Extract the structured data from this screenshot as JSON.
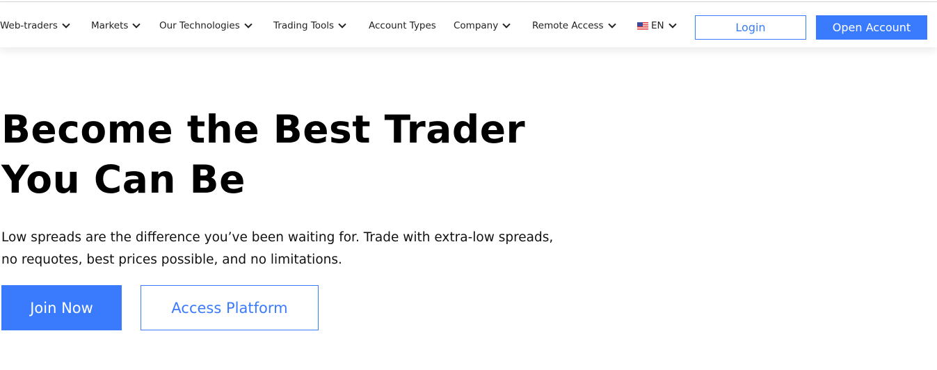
{
  "colors": {
    "accent": "#3a7bfd",
    "text": "#111111",
    "background": "#ffffff"
  },
  "nav": {
    "items": [
      {
        "label": "Web-traders",
        "dropdown": true
      },
      {
        "label": "Markets",
        "dropdown": true
      },
      {
        "label": "Our Technologies",
        "dropdown": true
      },
      {
        "label": "Trading Tools",
        "dropdown": true
      },
      {
        "label": "Account Types",
        "dropdown": false
      },
      {
        "label": "Company",
        "dropdown": true
      },
      {
        "label": "Remote Access",
        "dropdown": true
      }
    ],
    "language": {
      "label": "EN",
      "icon": "us-flag-icon"
    },
    "login_label": "Login",
    "open_account_label": "Open Account"
  },
  "hero": {
    "title_line1": "Become the Best Trader",
    "title_line2": "You Can Be",
    "subtitle": "Low spreads are the difference you’ve been waiting for. Trade with extra-low spreads, no requotes, best prices possible, and no limitations.",
    "join_label": "Join Now",
    "access_label": "Access Platform"
  }
}
